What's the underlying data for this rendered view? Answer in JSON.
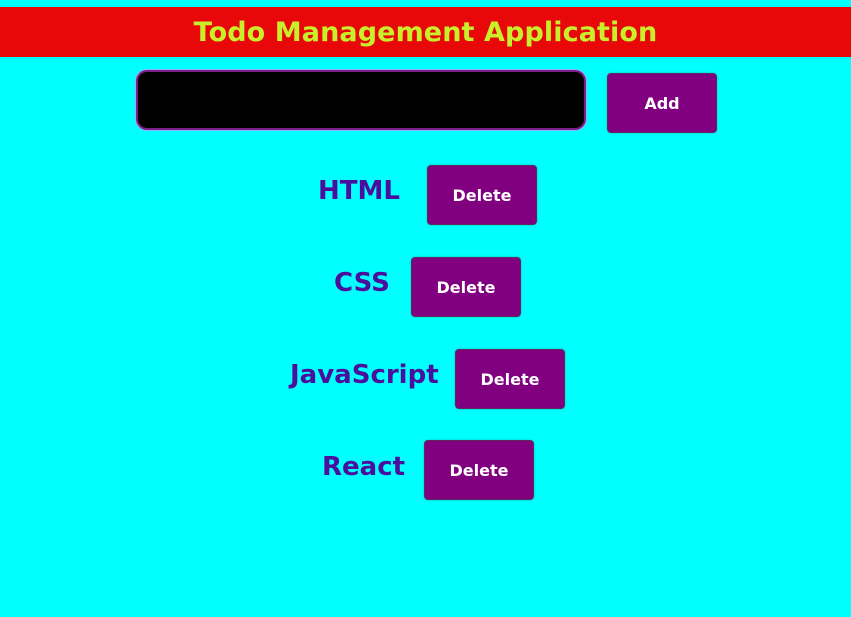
{
  "app": {
    "title": "Todo Management Application"
  },
  "input": {
    "value": "",
    "placeholder": ""
  },
  "add_button": {
    "label": "Add"
  },
  "todos": [
    {
      "text": "HTML",
      "delete_label": "Delete"
    },
    {
      "text": "CSS",
      "delete_label": "Delete"
    },
    {
      "text": "JavaScript",
      "delete_label": "Delete"
    },
    {
      "text": "React",
      "delete_label": "Delete"
    }
  ],
  "colors": {
    "page_background": "#00ffff",
    "header_background": "#e8080a",
    "header_text": "#c9ef2a",
    "button_background": "#800080",
    "todo_text": "#4a0f9c",
    "input_background": "#000000"
  }
}
